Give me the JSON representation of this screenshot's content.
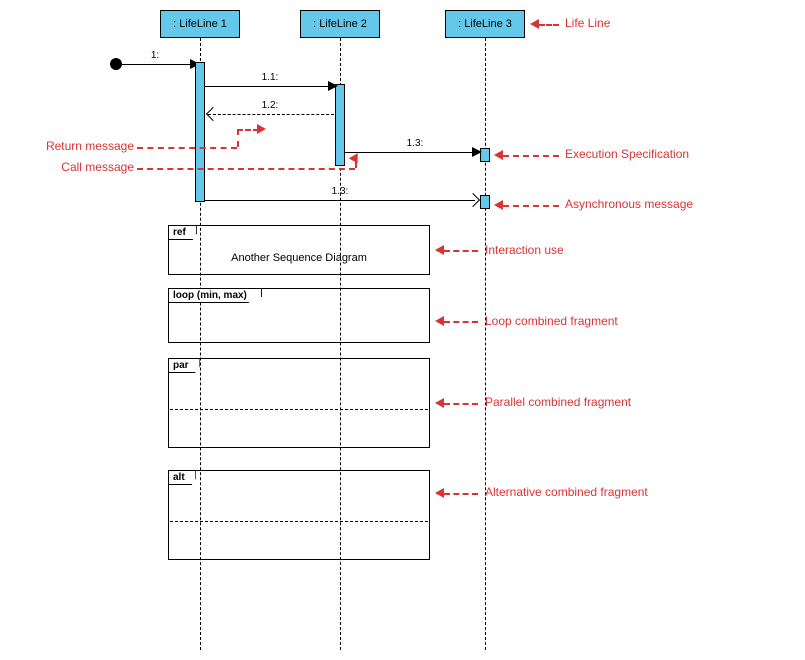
{
  "lifelines": {
    "l1": ": LifeLine 1",
    "l2": ": LifeLine 2",
    "l3": ": LifeLine 3"
  },
  "messages": {
    "found": "1:",
    "m11": "1.1:",
    "m12": "1.2:",
    "m13a": "1.3:",
    "m13b": "1.3:"
  },
  "fragments": {
    "ref_tag": "ref",
    "ref_text": "Another Sequence Diagram",
    "loop_tag": "loop (min, max)",
    "par_tag": "par",
    "alt_tag": "alt"
  },
  "annotations": {
    "life_line": "Life Line",
    "exec_spec": "Execution Specification",
    "async_msg": "Asynchronous message",
    "interaction_use": "Interaction use",
    "loop_fragment": "Loop combined fragment",
    "parallel_fragment": "Parallel combined fragment",
    "alt_fragment": "Alternative combined fragment",
    "return_msg": "Return message",
    "call_msg": "Call message"
  }
}
